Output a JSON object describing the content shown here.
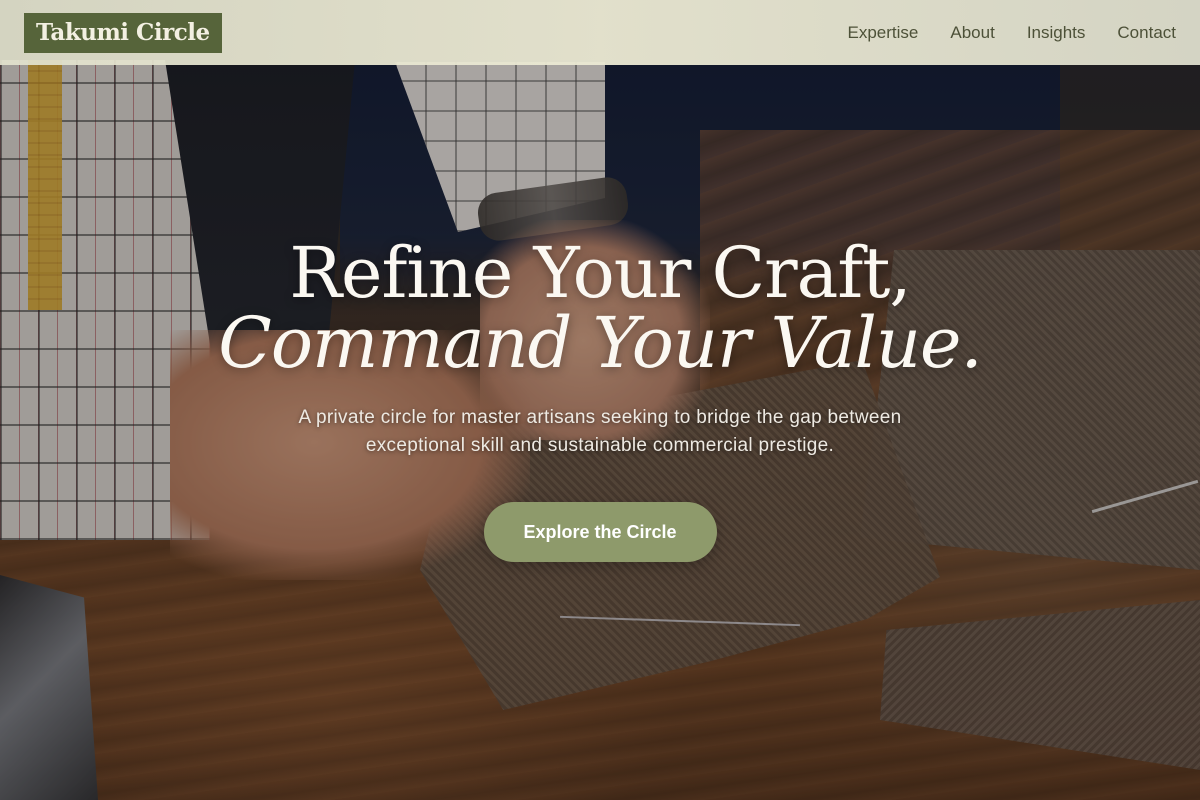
{
  "brand": {
    "name": "Takumi Circle"
  },
  "nav": {
    "links": [
      {
        "label": "Expertise"
      },
      {
        "label": "About"
      },
      {
        "label": "Insights"
      },
      {
        "label": "Contact"
      }
    ]
  },
  "hero": {
    "headline_line1": "Refine Your Craft,",
    "headline_line2": "Command Your Value.",
    "tagline": "A private circle for master artisans seeking to bridge the gap between exceptional skill and sustainable commercial prestige.",
    "cta_label": "Explore the Circle",
    "image_description": "tailor cutting herringbone tweed fabric on a wooden workbench"
  },
  "colors": {
    "brand_green": "#56643a",
    "nav_background": "#e8e7d2",
    "cta_background": "#8e9a6b",
    "nav_text": "#4d5138"
  }
}
